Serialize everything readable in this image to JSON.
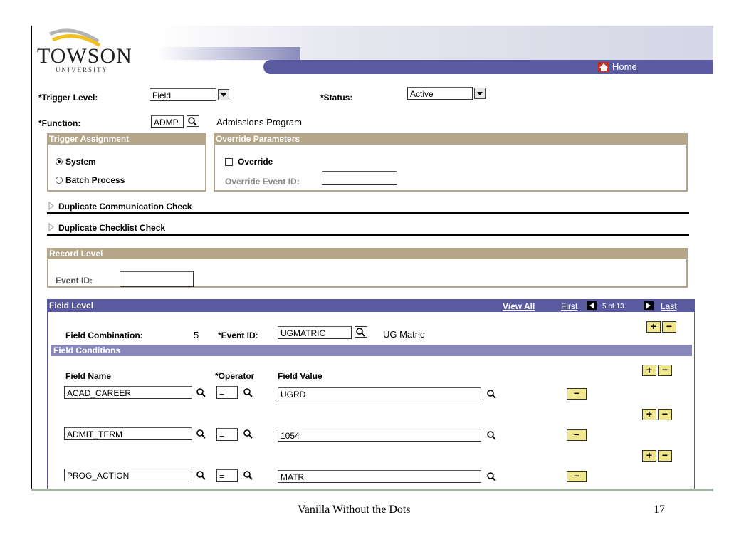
{
  "brand": {
    "name": "TOWSON",
    "sub": "UNIVERSITY",
    "home_label": "Home"
  },
  "trigger": {
    "label": "*Trigger Level:",
    "value": "Field"
  },
  "status": {
    "label": "*Status:",
    "value": "Active"
  },
  "function": {
    "label": "*Function:",
    "value": "ADMP",
    "desc": "Admissions Program"
  },
  "trigger_assignment": {
    "title": "Trigger Assignment",
    "options": [
      "System",
      "Batch Process"
    ],
    "selected": "System"
  },
  "override_params": {
    "title": "Override Parameters",
    "override_label": "Override",
    "event_id_label": "Override Event ID:",
    "event_id_value": ""
  },
  "collapsibles": [
    "Duplicate Communication Check",
    "Duplicate Checklist Check"
  ],
  "record_level": {
    "title": "Record Level",
    "event_id_label": "Event ID:",
    "event_id_value": ""
  },
  "field_level": {
    "title": "Field Level",
    "view_all": "View All",
    "first": "First",
    "range": "5 of 13",
    "last": "Last",
    "combo_label": "Field Combination:",
    "combo_value": "5",
    "event_id_label": "*Event ID:",
    "event_id_value": "UGMATRIC",
    "event_desc": "UG Matric"
  },
  "conditions": {
    "title": "Field Conditions",
    "col_name": "Field Name",
    "col_operator": "*Operator",
    "col_value": "Field Value",
    "rows": [
      {
        "name": "ACAD_CAREER",
        "op": "=",
        "value": "UGRD"
      },
      {
        "name": "ADMIT_TERM",
        "op": "=",
        "value": "1054"
      },
      {
        "name": "PROG_ACTION",
        "op": "=",
        "value": "MATR"
      }
    ]
  },
  "buttons": {
    "plus": "+",
    "minus": "−"
  },
  "footer": {
    "title": "Vanilla Without the Dots",
    "page": "17"
  },
  "colors": {
    "header_blue": "#5a5aa0",
    "section_tan": "#b5a58a",
    "button_yellow": "#f0e68c"
  }
}
